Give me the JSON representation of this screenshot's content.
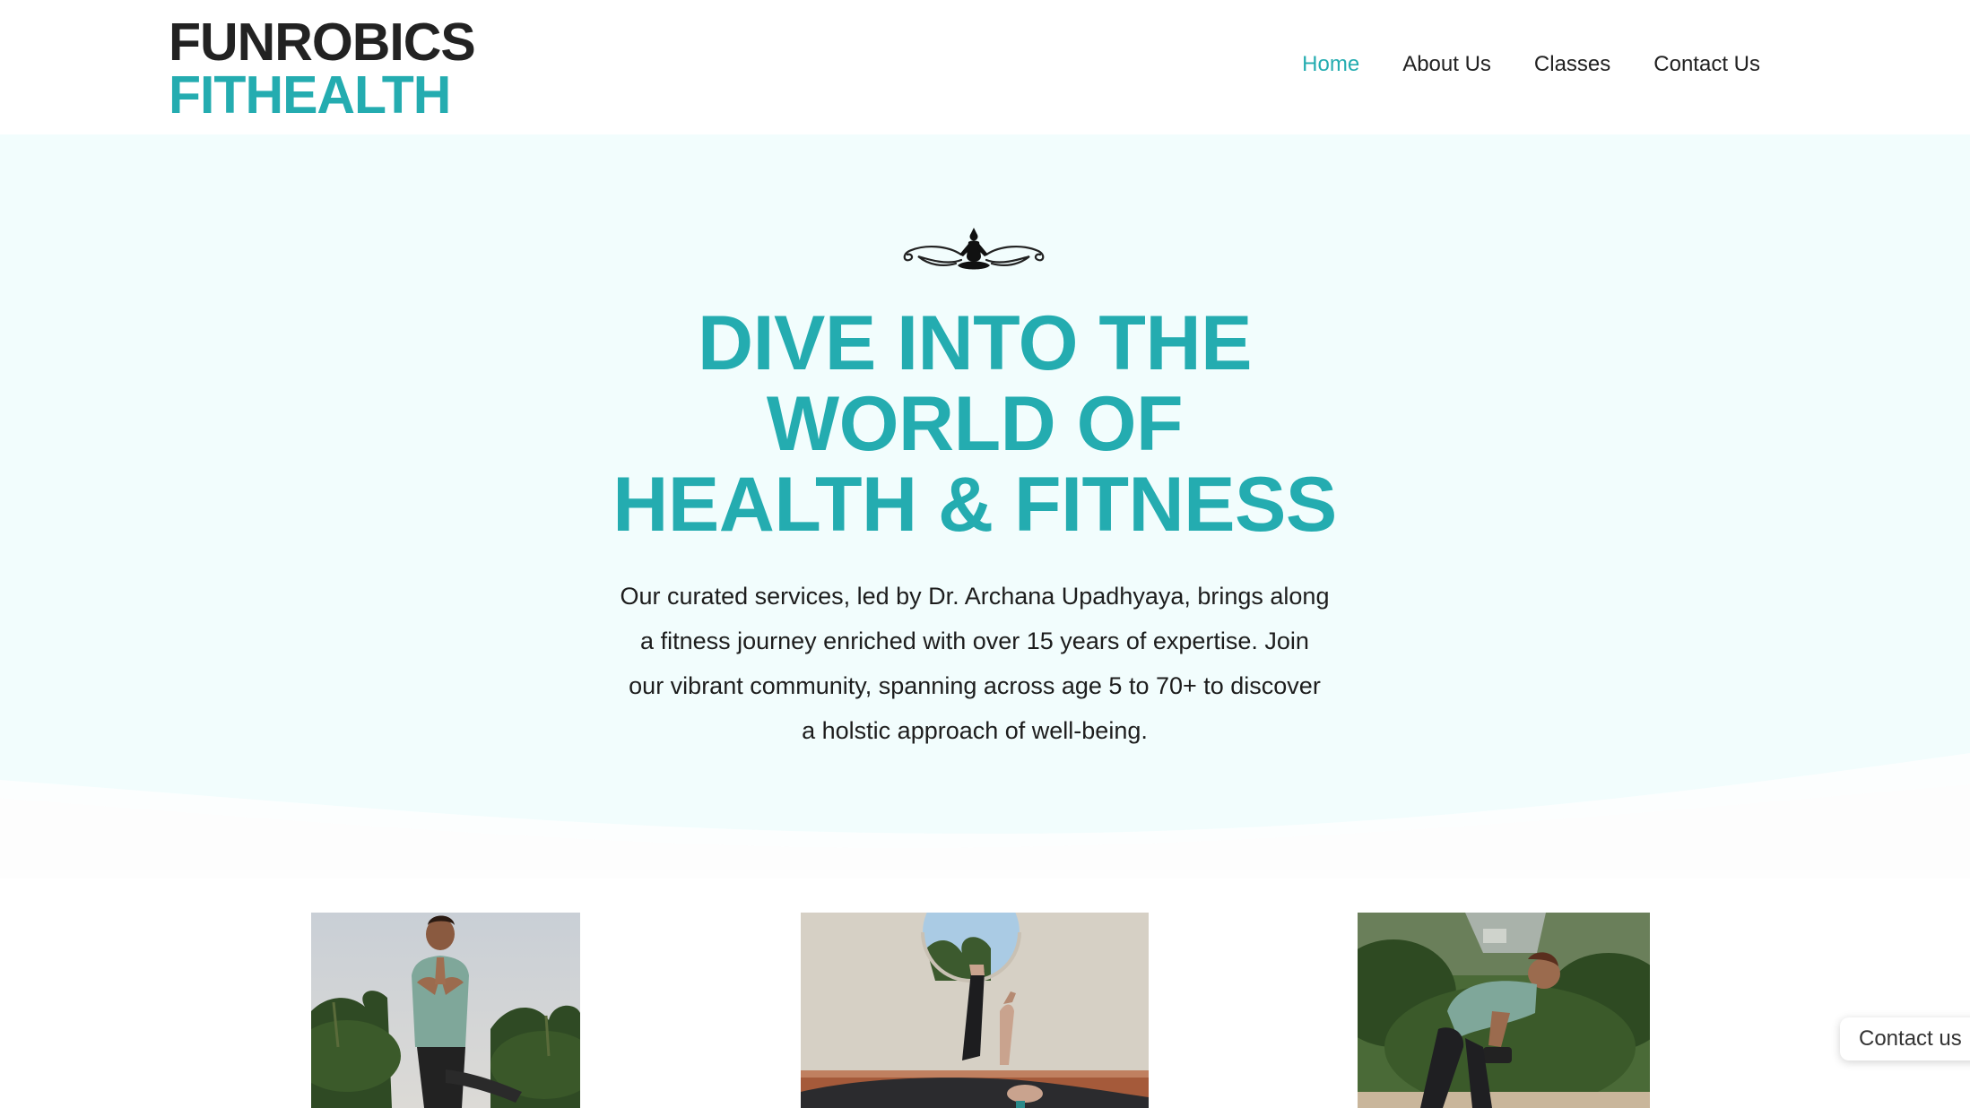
{
  "brand": {
    "line1": "FUNROBICS",
    "line2": "FITHEALTH"
  },
  "nav": {
    "items": [
      {
        "label": "Home",
        "active": true
      },
      {
        "label": "About Us",
        "active": false
      },
      {
        "label": "Classes",
        "active": false
      },
      {
        "label": "Contact Us",
        "active": false
      }
    ]
  },
  "hero": {
    "ornament_icon": "yoga-pose-ornament-icon",
    "headline_lines": [
      "DIVE INTO THE",
      "WORLD OF",
      "HEALTH & FITNESS"
    ],
    "intro_lines": [
      "Our curated services, led by Dr. Archana Upadhyaya, brings along",
      "a fitness journey enriched with over 15 years of expertise. Join",
      "our vibrant community, spanning across age 5 to 70+ to discover",
      "a holstic approach of well-being."
    ]
  },
  "floating_contact": {
    "label": "Contact us"
  },
  "colors": {
    "accent": "#24acb0",
    "hero_background": "#f2fdfd",
    "text": "#222222"
  }
}
